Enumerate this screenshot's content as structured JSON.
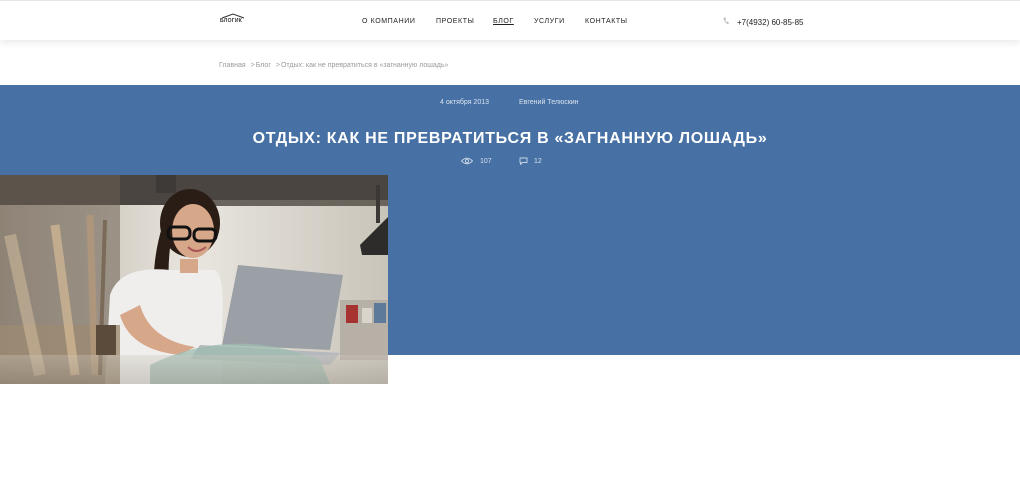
{
  "header": {
    "logo_text": "БЛОГИК",
    "nav": [
      "О КОМПАНИИ",
      "ПРОЕКТЫ",
      "БЛОГ",
      "УСЛУГИ",
      "КОНТАКТЫ"
    ],
    "phone": "+7(4932) 60-85-85"
  },
  "breadcrumbs": {
    "home": "Главная",
    "section": "Блог",
    "current": "Отдых: как не превратиться в «загнанную лошадь»"
  },
  "article": {
    "date": "4 октября 2013",
    "author": "Евгений Телюскин",
    "title": "ОТДЫХ: КАК НЕ ПРЕВРАТИТЬСЯ В «ЗАГНАННУЮ ЛОШАДЬ»",
    "views": "107",
    "comments": "12"
  },
  "colors": {
    "banner": "#4770a4",
    "header_bg": "#ffffff"
  },
  "icons": [
    "logo-roof-icon",
    "phone-icon",
    "eye-icon",
    "comment-icon"
  ]
}
